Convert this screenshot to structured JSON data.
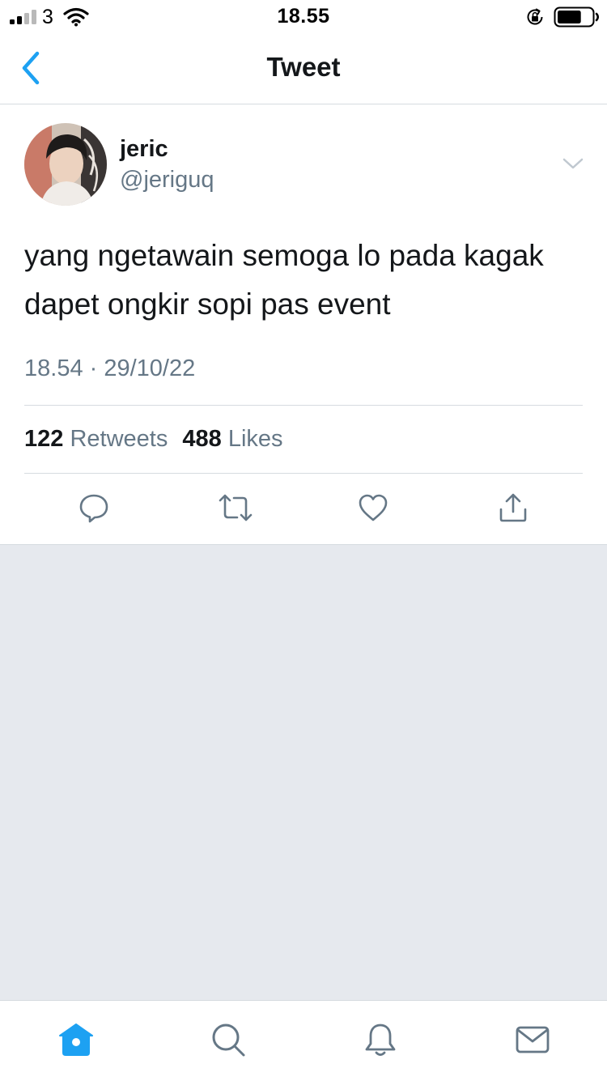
{
  "status_bar": {
    "carrier": "3",
    "time": "18.55",
    "signal_bars_filled": 2,
    "signal_bars_total": 4,
    "battery_level": 0.7
  },
  "nav": {
    "title": "Tweet",
    "back_icon": "chevron-left-icon"
  },
  "tweet": {
    "author": {
      "name": "jeric",
      "handle": "@jeriguq"
    },
    "text": "yang ngetawain semoga lo pada kagak\ndapet ongkir sopi pas event",
    "timestamp": "18.54 · 29/10/22",
    "stats": {
      "retweets_count": "122",
      "retweets_label": "Retweets",
      "likes_count": "488",
      "likes_label": "Likes"
    },
    "actions": [
      "reply-icon",
      "retweet-icon",
      "like-icon",
      "share-icon"
    ]
  },
  "tab_bar": {
    "tabs": [
      "home-icon",
      "search-icon",
      "notifications-icon",
      "messages-icon"
    ],
    "active": "home-icon"
  },
  "colors": {
    "accent": "#1da1f2",
    "secondary_text": "#657786",
    "icon_gray": "#657786",
    "empty_background": "#e6e9ee",
    "divider": "#d6dbe0"
  }
}
